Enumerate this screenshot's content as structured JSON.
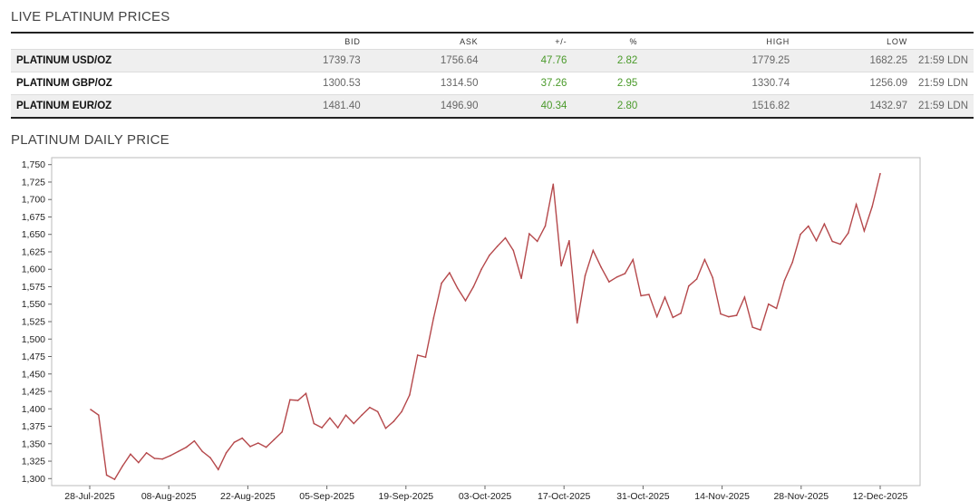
{
  "prices": {
    "title": "LIVE PLATINUM PRICES",
    "columns": [
      "",
      "BID",
      "ASK",
      "+/-",
      "%",
      "HIGH",
      "LOW",
      ""
    ],
    "rows": [
      {
        "name": "PLATINUM USD/OZ",
        "bid": "1739.73",
        "ask": "1756.64",
        "change": "47.76",
        "pct": "2.82",
        "high": "1779.25",
        "low": "1682.25",
        "time": "21:59 LDN"
      },
      {
        "name": "PLATINUM GBP/OZ",
        "bid": "1300.53",
        "ask": "1314.50",
        "change": "37.26",
        "pct": "2.95",
        "high": "1330.74",
        "low": "1256.09",
        "time": "21:59 LDN"
      },
      {
        "name": "PLATINUM EUR/OZ",
        "bid": "1481.40",
        "ask": "1496.90",
        "change": "40.34",
        "pct": "2.80",
        "high": "1516.82",
        "low": "1432.97",
        "time": "21:59 LDN"
      }
    ],
    "up_color": "#4a9a2a"
  },
  "chart": {
    "title": "PLATINUM DAILY PRICE"
  },
  "chart_data": {
    "type": "line",
    "title": "",
    "xlabel": "",
    "ylabel": "",
    "ylim": [
      1290,
      1760
    ],
    "line_color": "#b5484b",
    "grid": false,
    "y_ticks": [
      1300,
      1325,
      1350,
      1375,
      1400,
      1425,
      1450,
      1475,
      1500,
      1525,
      1550,
      1575,
      1600,
      1625,
      1650,
      1675,
      1700,
      1725,
      1750
    ],
    "x_tick_labels": [
      "28-Jul-2025",
      "08-Aug-2025",
      "22-Aug-2025",
      "05-Sep-2025",
      "19-Sep-2025",
      "03-Oct-2025",
      "17-Oct-2025",
      "31-Oct-2025",
      "14-Nov-2025",
      "28-Nov-2025",
      "12-Dec-2025"
    ],
    "series": [
      {
        "values": [
          1399,
          1391,
          1305,
          1299,
          1318,
          1335,
          1323,
          1337,
          1329,
          1328,
          1333,
          1339,
          1345,
          1354,
          1339,
          1330,
          1313,
          1337,
          1352,
          1358,
          1346,
          1351,
          1345,
          1356,
          1367,
          1413,
          1412,
          1422,
          1379,
          1373,
          1387,
          1373,
          1391,
          1379,
          1391,
          1402,
          1396,
          1372,
          1382,
          1396,
          1420,
          1477,
          1474,
          1530,
          1580,
          1595,
          1573,
          1555,
          1575,
          1600,
          1620,
          1633,
          1645,
          1627,
          1587,
          1651,
          1640,
          1662,
          1722,
          1605,
          1641,
          1523,
          1591,
          1627,
          1603,
          1582,
          1589,
          1594,
          1614,
          1562,
          1564,
          1532,
          1560,
          1531,
          1537,
          1576,
          1586,
          1614,
          1588,
          1536,
          1532,
          1534,
          1560,
          1517,
          1513,
          1550,
          1544,
          1584,
          1610,
          1650,
          1662,
          1641,
          1665,
          1640,
          1636,
          1652,
          1693,
          1655,
          1690,
          1737
        ]
      }
    ]
  }
}
